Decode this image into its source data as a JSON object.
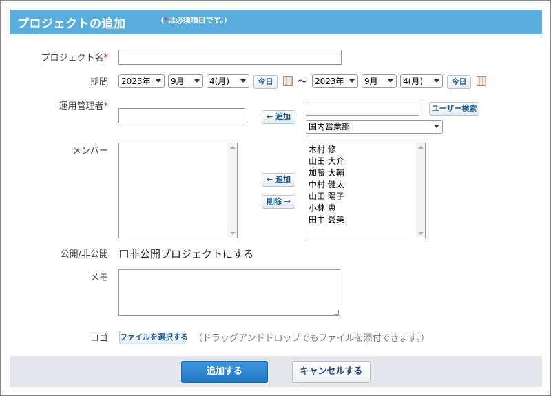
{
  "header": {
    "title": "プロジェクトの追加",
    "required_note_prefix": "（",
    "required_star": "*",
    "required_note_text": "は必須項目です。）"
  },
  "form": {
    "project_name": {
      "label": "プロジェクト名",
      "star": "*",
      "value": ""
    },
    "period": {
      "label": "期間",
      "start": {
        "year": "2023年",
        "month": "9月",
        "day": "4(月)"
      },
      "end": {
        "year": "2023年",
        "month": "9月",
        "day": "4(月)"
      },
      "today_label": "今日",
      "separator": "〜"
    },
    "manager": {
      "label": "運用管理者",
      "star": "*",
      "value": "",
      "add_button": "← 追加",
      "search_value": "",
      "search_button": "ユーザー検索",
      "department": "国内営業部"
    },
    "members": {
      "label": "メンバー",
      "add_button": "← 追加",
      "remove_button": "削除 →",
      "selected": [],
      "candidates": [
        "木村 修",
        "山田 大介",
        "加藤 大輔",
        "中村 健太",
        "山田 陽子",
        "小林 恵",
        "田中 愛美"
      ]
    },
    "visibility": {
      "label": "公開/非公開",
      "checkbox_label": "非公開プロジェクトにする",
      "checked": false
    },
    "memo": {
      "label": "メモ",
      "value": ""
    },
    "logo": {
      "label": "ロゴ",
      "file_button": "ファイルを選択する",
      "hint": "（ドラッグアンドドロップでもファイルを添付できます。）"
    }
  },
  "footer": {
    "submit_label": "追加する",
    "cancel_label": "キャンセルする"
  },
  "colors": {
    "header_bg": "#5aaede",
    "primary_button": "#2a84cc",
    "required_star": "#d93030",
    "footer_bg": "#e3e7ec"
  }
}
